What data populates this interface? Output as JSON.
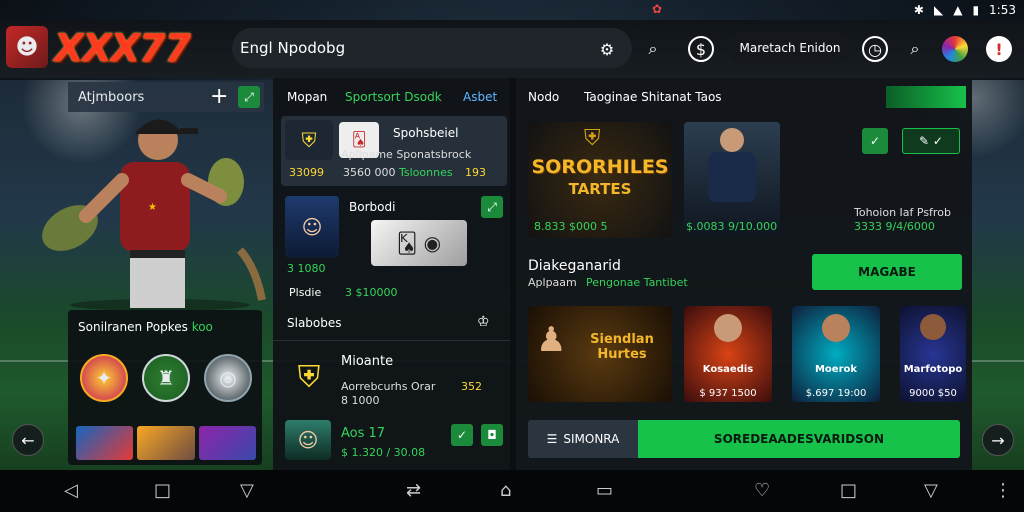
{
  "status_bar": {
    "time": "1:53",
    "center_icon": "notification-icon",
    "icons": [
      "bluetooth-icon",
      "wifi-icon",
      "signal-icon",
      "battery-icon"
    ]
  },
  "header": {
    "brand": "XXX77",
    "search_value": "Engl Npodobg",
    "pill_label": "Maretach Enidon"
  },
  "left_panel": {
    "title": "Atjmboors",
    "popular_title": "Sonilranen Popkes",
    "popular_accent": "koo"
  },
  "middle_panel": {
    "tabs": [
      "Mopan",
      "Sportsort Dsodk",
      "Asbet"
    ],
    "games": [
      {
        "title": "Spohsbeiel",
        "subtitle": "Apllpame Sponatsbrock",
        "value_left": "33099",
        "value_mid": "3560 000",
        "value_right": "Tsloonnes",
        "value_extra": "193"
      },
      {
        "title": "Borbodi",
        "value_left": "3 1080",
        "value_bottom": "Plsdie",
        "value_bottom2": "3 $10000"
      },
      {
        "title": "Slabobes"
      },
      {
        "title": "Mioante",
        "subtitle": "Aorrebcurhs Orar",
        "value_extra": "352",
        "value_small": "8 1000"
      },
      {
        "title": "Aos 17",
        "value_left": "$ 1.320 / 30.08"
      }
    ]
  },
  "right_panel": {
    "tabs": [
      "Nodo",
      "Taoginae Shitanat Taos"
    ],
    "featured_logo_line1": "SORORHILES",
    "featured_logo_line2": "TARTES",
    "featured_values": "8.833 $000 5",
    "player_values": "$.0083 9/10.000",
    "side_label": "Tohoion Iaf Psfrob",
    "side_values": "3333 9/4/6000",
    "section_title": "Diakeganarid",
    "section_sub1": "Aplpaam",
    "section_sub2": "Pengonae Tantibet",
    "section_button": "MAGABE",
    "tiles": [
      {
        "name": "Siendlan Hurtes",
        "value": ""
      },
      {
        "name": "Kosaedis",
        "value": "$ 937 1500"
      },
      {
        "name": "Moerok",
        "value": "$.697 19:00"
      },
      {
        "name": "Marfotopo",
        "value": "9000 $50"
      }
    ],
    "bottom_left": "SIMONRA",
    "bottom_right": "SOREDEAADESVARIDSON"
  },
  "colors": {
    "accent_green": "#16c24a",
    "brand_red": "#ff3b1f",
    "panel_bg": "#12161a"
  }
}
